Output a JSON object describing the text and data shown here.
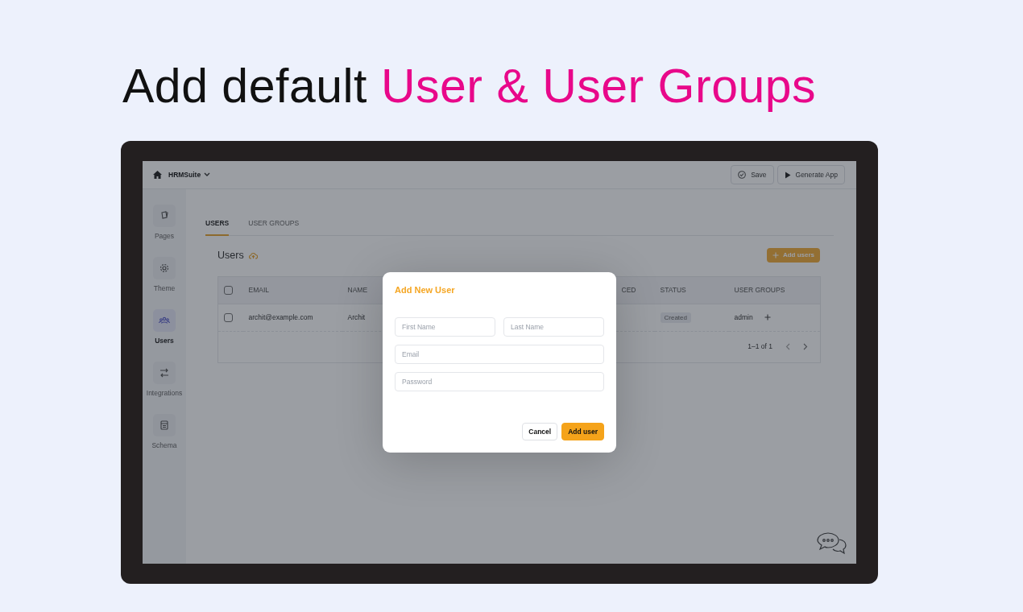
{
  "headline": [
    {
      "text": "Add default",
      "accent": false
    },
    {
      "text": "User & User Groups",
      "accent": true
    }
  ],
  "topbar": {
    "project": "HRMSuite",
    "buttons": [
      {
        "label": "Save",
        "kind": "save"
      },
      {
        "label": "Generate App",
        "kind": "play"
      }
    ]
  },
  "sidebar": {
    "items": [
      {
        "label": "Pages",
        "kind": "pages",
        "selected": false
      },
      {
        "label": "Theme",
        "kind": "theme",
        "selected": false
      },
      {
        "label": "Users",
        "kind": "users",
        "selected": true
      },
      {
        "label": "Integrations",
        "kind": "integrations",
        "selected": false
      },
      {
        "label": "Schema",
        "kind": "schema",
        "selected": false
      }
    ]
  },
  "tabs": [
    {
      "label": "USERS",
      "selected": true
    },
    {
      "label": "USER GROUPS",
      "selected": false
    }
  ],
  "section": {
    "title": "Users",
    "action": "Add users"
  },
  "table": {
    "header_checked": false,
    "columns": [
      "EMAIL",
      "NAME",
      "CED",
      "STATUS",
      "USER GROUPS"
    ],
    "rows": [
      {
        "checked": false,
        "email": "archit@example.com",
        "name": "Archit",
        "status": "Created",
        "user_groups": "admin"
      }
    ],
    "pagination": "1–1 of 1"
  },
  "modal": {
    "title": "Add New User",
    "field_rows": [
      [
        {
          "placeholder": "First Name"
        },
        {
          "placeholder": "Last Name"
        }
      ],
      [
        {
          "placeholder": "Email"
        }
      ],
      [
        {
          "placeholder": "Password"
        }
      ]
    ],
    "buttons": [
      {
        "label": "Cancel",
        "kind": "secondary"
      },
      {
        "label": "Add user",
        "kind": "primary"
      }
    ]
  }
}
